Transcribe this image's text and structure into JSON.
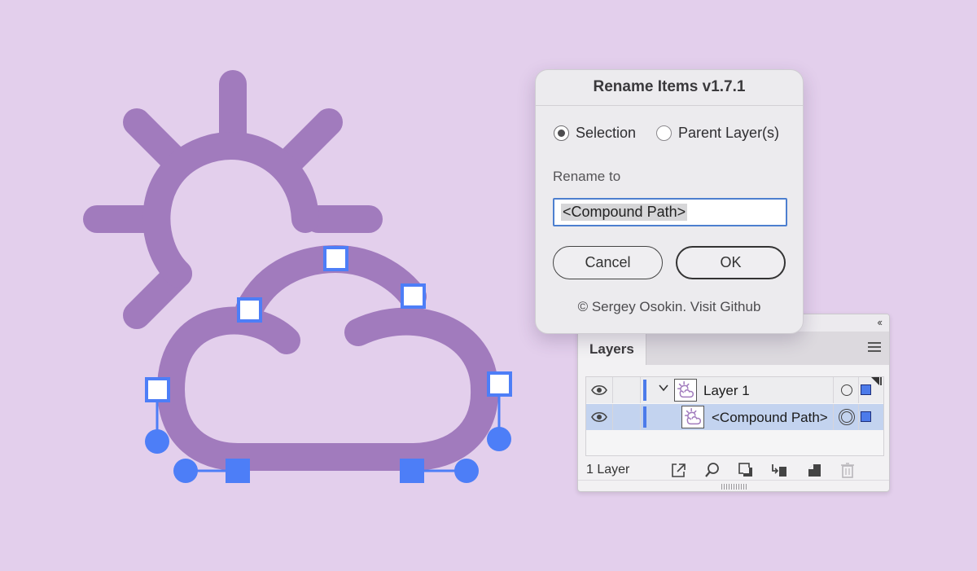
{
  "canvas": {
    "background": "#e3cfec",
    "icon_color": "#a17bbd",
    "handle_color": "#4d7ef7",
    "artwork": "weather-partly-cloudy-icon"
  },
  "dialog": {
    "title": "Rename Items v1.7.1",
    "options": [
      {
        "label": "Selection",
        "selected": true
      },
      {
        "label": "Parent Layer(s)",
        "selected": false
      }
    ],
    "rename_label": "Rename to",
    "input_value": "<Compound Path>",
    "cancel_label": "Cancel",
    "ok_label": "OK",
    "credit": "© Sergey Osokin. Visit Github"
  },
  "layers_panel": {
    "collapse_glyph": "‹‹",
    "tab_label": "Layers",
    "rows": [
      {
        "name": "Layer 1",
        "expanded": true,
        "visible": true,
        "selected": false
      },
      {
        "name": "<Compound Path>",
        "expanded": false,
        "visible": true,
        "selected": true
      }
    ],
    "layer_count": "1 Layer",
    "footer_icons": [
      "collect-for-export-icon",
      "locate-object-icon",
      "make-clipping-mask-icon",
      "new-sublayer-icon",
      "new-layer-icon",
      "delete-icon"
    ]
  }
}
